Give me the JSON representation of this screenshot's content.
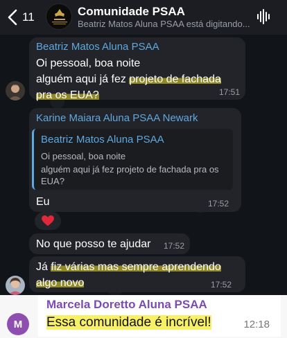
{
  "header": {
    "back_count": "11",
    "title": "Comunidade PSAA",
    "subtitle": "Beatriz Matos Aluna PSAA está digitando...",
    "group_avatar_text": "PSA SABINTO DA AMÉRICA"
  },
  "messages": [
    {
      "sender": "Beatriz Matos Aluna PSAA",
      "line1": "Oi pessoal, boa noite",
      "line2": "alguém aqui já fez ",
      "line2_highlight": "projeto de fachada",
      "line3_highlight": "pra os EUA?",
      "time": "17:51"
    },
    {
      "sender": "Karine Maiara Aluna PSAA Newark",
      "quote_sender": "Beatriz Matos Aluna PSAA",
      "quote_line1": "Oi pessoal, boa noite",
      "quote_line2": "alguém aqui já fez projeto de fachada pra os",
      "quote_line3": "EUA?",
      "text": "Eu",
      "time": "17:52"
    },
    {
      "text": "No que posso te ajudar",
      "time": "17:52"
    },
    {
      "line1_pre": "Já ",
      "line1_highlight": "fiz várias mas sempre aprendendo",
      "line2_highlight": "algo novo",
      "time": "17:52"
    }
  ],
  "reaction": {
    "emoji": "heart"
  },
  "bottom": {
    "avatar_letter": "M",
    "sender": "Marcela Doretto Aluna PSAA",
    "text": "Essa comunidade é incrível!",
    "time": "12:18"
  },
  "colors": {
    "sender_blue": "#5fa8e0",
    "highlight_yellow": "#eedc28",
    "bottom_sender_purple": "#7b4bb0",
    "avatar_purple": "#8f4fb0",
    "bubble_bg": "#222429"
  }
}
